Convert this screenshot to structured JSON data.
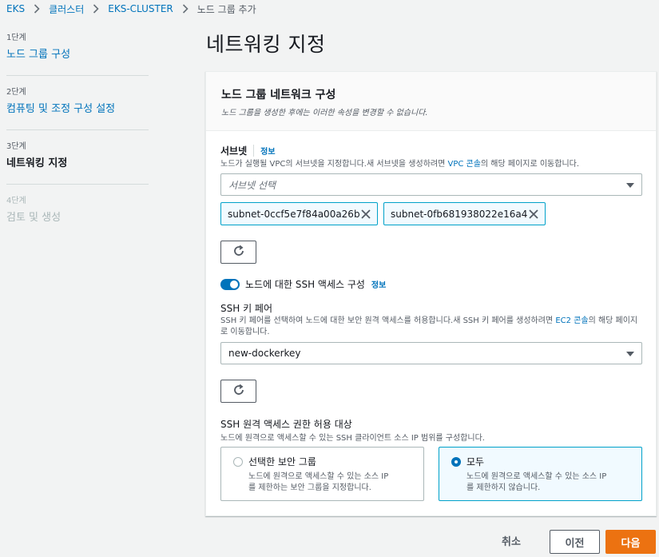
{
  "breadcrumb": [
    "EKS",
    "클러스터",
    "EKS-CLUSTER",
    "노드 그룹 추가"
  ],
  "steps": [
    {
      "num": "1단계",
      "name": "노드 그룹 구성"
    },
    {
      "num": "2단계",
      "name": "컴퓨팅 및 조정 구성 설정"
    },
    {
      "num": "3단계",
      "name": "네트워킹 지정"
    },
    {
      "num": "4단계",
      "name": "검토 및 생성"
    }
  ],
  "page_title": "네트워킹 지정",
  "panel": {
    "title": "노드 그룹 네트워크 구성",
    "desc": "노드 그룹을 생성한 후에는 이러한 속성을 변경할 수 없습니다."
  },
  "subnet": {
    "label": "서브넷",
    "info": "정보",
    "desc_before": "노드가 실행될 VPC의 서브넷을 지정합니다.새 서브넷을 생성하려면 ",
    "desc_link": "VPC 콘솔",
    "desc_after": "의 해당 페이지로 이동합니다.",
    "placeholder": "서브넷 선택",
    "tokens": [
      "subnet-0ccf5e7f84a00a26b",
      "subnet-0fb681938022e16a4"
    ]
  },
  "ssh_toggle": {
    "label": "노드에 대한 SSH 액세스 구성",
    "info": "정보",
    "enabled": true
  },
  "ssh_key": {
    "label": "SSH 키 페어",
    "desc_before": "SSH 키 페어를 선택하여 노드에 대한 보안 원격 액세스를 허용합니다.새 SSH 키 페어를 생성하려면 ",
    "desc_link": "EC2 콘솔",
    "desc_after": "의 해당 페이지로 이동합니다.",
    "value": "new-dockerkey"
  },
  "ssh_source": {
    "label": "SSH 원격 액세스 권한 허용 대상",
    "desc": "노드에 원격으로 액세스할 수 있는 SSH 클라이언트 소스 IP 범위를 구성합니다.",
    "options": [
      {
        "title": "선택한 보안 그룹",
        "desc1": "노드에 원격으로 액세스할 수 있는 소스 IP",
        "desc2": "를 제한하는 보안 그룹을 지정합니다."
      },
      {
        "title": "모두",
        "desc1": "노드에 원격으로 액세스할 수 있는 소스 IP",
        "desc2": "를 제한하지 않습니다."
      }
    ],
    "selected": "모두"
  },
  "footer": {
    "cancel": "취소",
    "prev": "이전",
    "next": "다음"
  },
  "colors": {
    "link": "#0073bb",
    "primary": "#ec7211",
    "selected_border": "#00a1c9"
  }
}
